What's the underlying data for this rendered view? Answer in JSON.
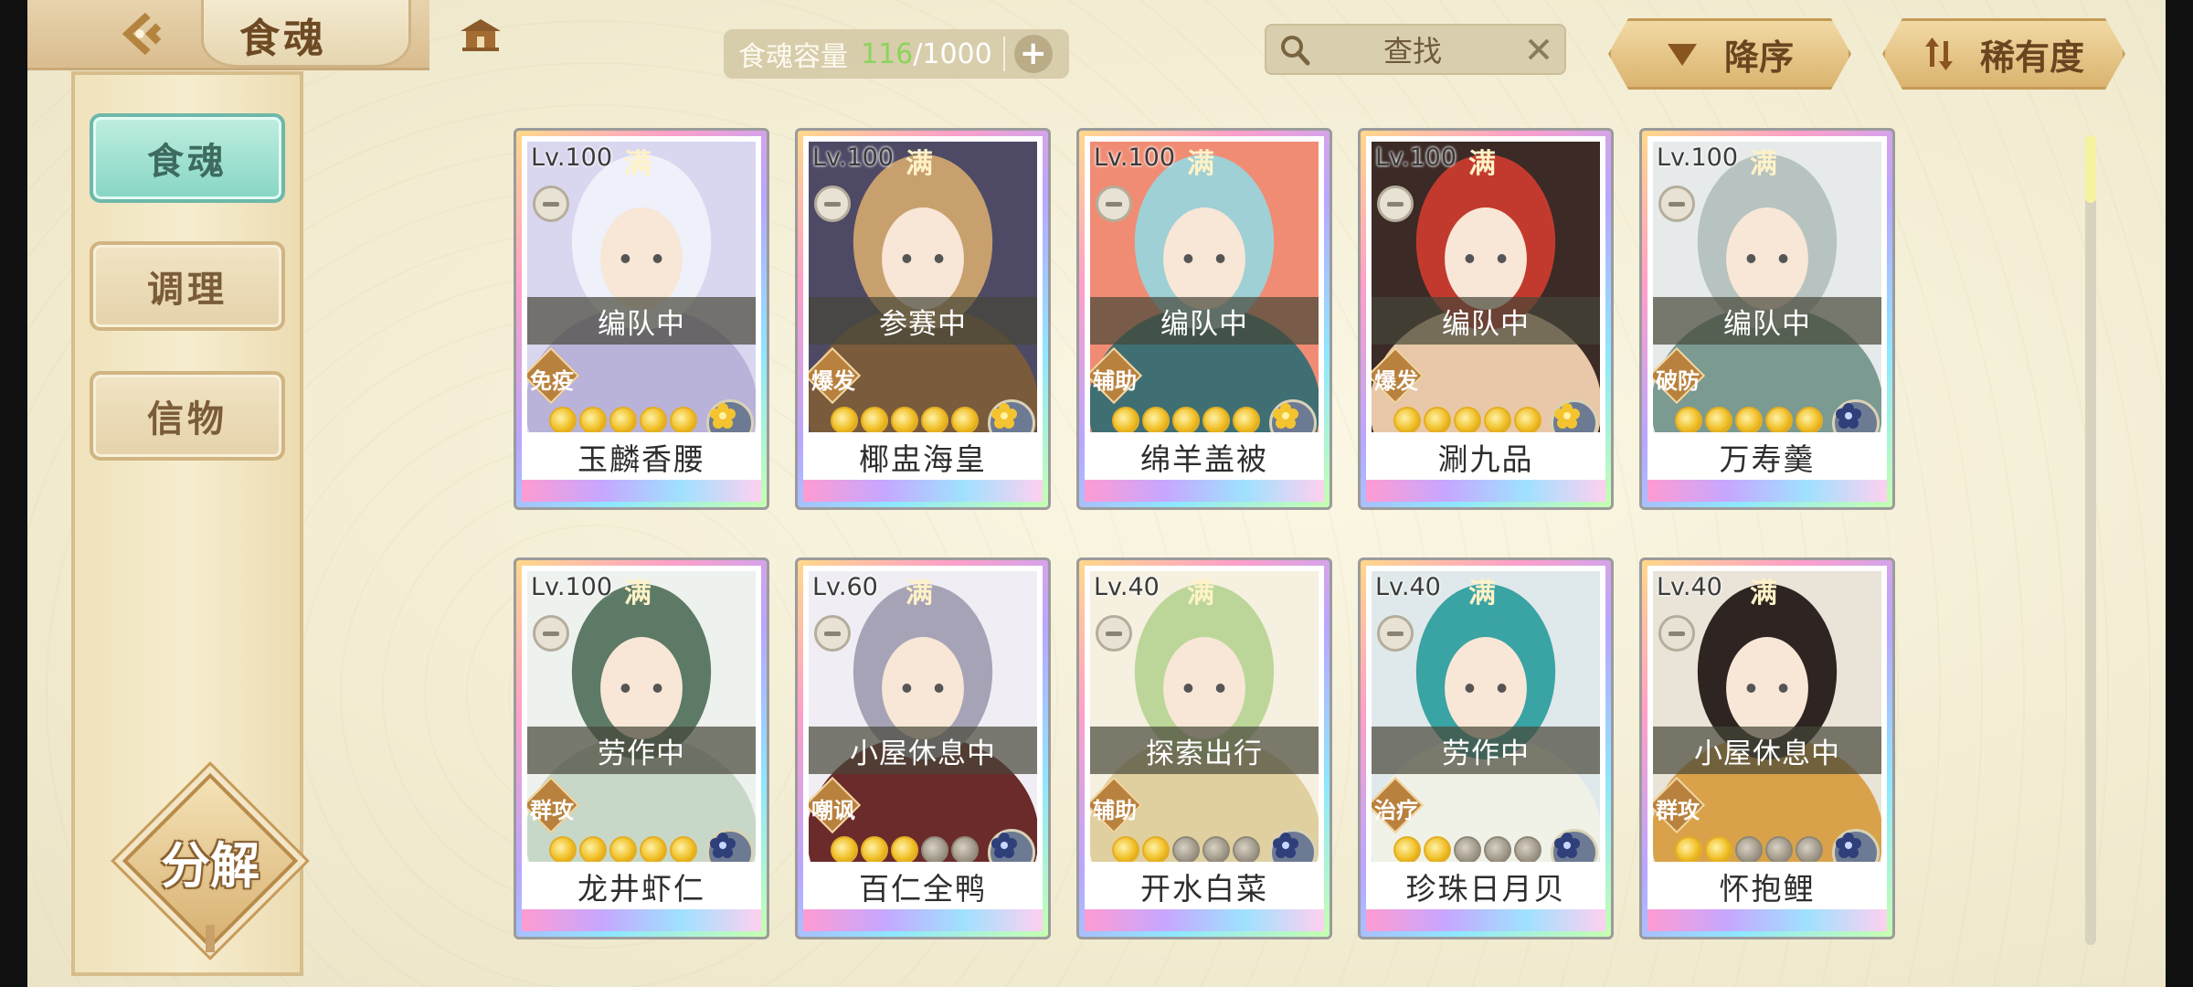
{
  "header": {
    "title": "食魂",
    "capacity_label": "食魂容量",
    "capacity_current": "116",
    "capacity_max": "/1000",
    "capacity_add": "+",
    "search_placeholder": "查找",
    "sort_order_label": "降序",
    "sort_key_label": "稀有度"
  },
  "sidebar": {
    "tabs": [
      {
        "label": "食魂",
        "active": true
      },
      {
        "label": "调理",
        "active": false
      },
      {
        "label": "信物",
        "active": false
      }
    ],
    "decompose_label": "分解"
  },
  "cards": [
    {
      "level": "Lv.100",
      "max": "满",
      "status": "编队中",
      "role": "免疫",
      "name": "玉麟香腰",
      "stars": 5,
      "element": "gold",
      "palette": [
        "#d9d6ef",
        "#eef0fa",
        "#b9b2d9"
      ]
    },
    {
      "level": "Lv.100",
      "max": "满",
      "status": "参赛中",
      "role": "爆发",
      "name": "椰盅海皇",
      "stars": 5,
      "element": "gold",
      "palette": [
        "#4e4a66",
        "#c8a06e",
        "#7a5b3c"
      ]
    },
    {
      "level": "Lv.100",
      "max": "满",
      "status": "编队中",
      "role": "辅助",
      "name": "绵羊盖被",
      "stars": 5,
      "element": "gold",
      "palette": [
        "#f08c74",
        "#9fd0d6",
        "#3f6f73"
      ]
    },
    {
      "level": "Lv.100",
      "max": "满",
      "status": "编队中",
      "role": "爆发",
      "name": "涮九品",
      "stars": 5,
      "element": "gold",
      "palette": [
        "#3b2a26",
        "#c23a2e",
        "#e8c8a8"
      ]
    },
    {
      "level": "Lv.100",
      "max": "满",
      "status": "编队中",
      "role": "破防",
      "name": "万寿羹",
      "stars": 5,
      "element": "blue",
      "palette": [
        "#e6eaea",
        "#b6c3c0",
        "#7a9a92"
      ]
    },
    {
      "level": "Lv.100",
      "max": "满",
      "status": "劳作中",
      "role": "群攻",
      "name": "龙井虾仁",
      "stars": 5,
      "element": "blue",
      "palette": [
        "#eef2ee",
        "#5d7a66",
        "#c8d8c8"
      ]
    },
    {
      "level": "Lv.60",
      "max": "满",
      "status": "小屋休息中",
      "role": "嘲讽",
      "name": "百仁全鸭",
      "stars": 3,
      "element": "blue",
      "palette": [
        "#f0eef4",
        "#a7a3b7",
        "#6b2b2b"
      ]
    },
    {
      "level": "Lv.40",
      "max": "满",
      "status": "探索出行",
      "role": "辅助",
      "name": "开水白菜",
      "stars": 2,
      "element": "blue",
      "palette": [
        "#f6f0e0",
        "#bcd69a",
        "#e0d0a0"
      ]
    },
    {
      "level": "Lv.40",
      "max": "满",
      "status": "劳作中",
      "role": "治疗",
      "name": "珍珠日月贝",
      "stars": 2,
      "element": "blue",
      "palette": [
        "#dfe8ea",
        "#3aa3a3",
        "#f0f2e8"
      ]
    },
    {
      "level": "Lv.40",
      "max": "满",
      "status": "小屋休息中",
      "role": "群攻",
      "name": "怀抱鲤",
      "stars": 2,
      "element": "blue",
      "palette": [
        "#e9e3d8",
        "#2e2522",
        "#d9a24a"
      ]
    }
  ]
}
